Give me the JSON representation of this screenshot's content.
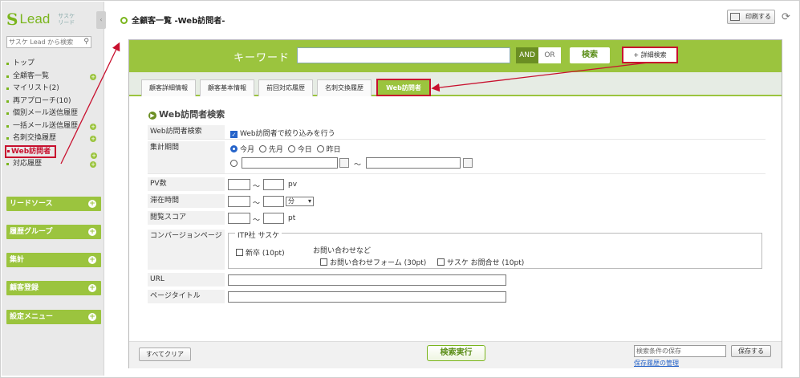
{
  "sidebar": {
    "logo_s": "S",
    "logo_text": "Lead",
    "logo_kana": "サスケ リード",
    "search_placeholder": "サスケ Lead から検索",
    "items": [
      {
        "label": "トップ"
      },
      {
        "label": "全顧客一覧"
      },
      {
        "label": "マイリスト(2)"
      },
      {
        "label": "再アプローチ(10)"
      },
      {
        "label": "個別メール送信履歴"
      },
      {
        "label": "一括メール送信履歴"
      },
      {
        "label": "名刺交換履歴"
      },
      {
        "label": "Web訪問者"
      },
      {
        "label": "対応履歴"
      }
    ],
    "groups": [
      {
        "label": "リードソース"
      },
      {
        "label": "履歴グループ"
      },
      {
        "label": "集計"
      },
      {
        "label": "顧客登録"
      },
      {
        "label": "設定メニュー"
      }
    ]
  },
  "header": {
    "title": "全顧客一覧 -Web訪問者-",
    "print_label": "印刷する"
  },
  "keyword": {
    "label": "キーワード",
    "value": "",
    "and_label": "AND",
    "or_label": "OR",
    "search_label": "検索",
    "advanced_label": "+ 詳細検索"
  },
  "tabs": [
    {
      "label": "顧客詳細情報"
    },
    {
      "label": "顧客基本情報"
    },
    {
      "label": "前回対応履歴"
    },
    {
      "label": "名刺交換履歴"
    },
    {
      "label": "Web訪問者"
    }
  ],
  "form": {
    "section_title": "Web訪問者検索",
    "visitor_label": "Web訪問者検索",
    "visitor_checkbox": "Web訪問者で絞り込みを行う",
    "period_label": "集計期間",
    "period_options": [
      "今月",
      "先月",
      "今日",
      "昨日"
    ],
    "period_selected": "今月",
    "range_sep": "～",
    "pv_label": "PV数",
    "pv_unit": "pv",
    "stay_label": "滞在時間",
    "stay_unit": "分",
    "score_label": "閲覧スコア",
    "score_unit": "pt",
    "conversion_label": "コンバージョンページ",
    "conv_group": "ITP社 サスケ",
    "conv_item1": "新卒 (10pt)",
    "conv_sub": "お問い合わせなど",
    "conv_item2": "お問い合わせフォーム (30pt)",
    "conv_item3": "サスケ お問合せ (10pt)",
    "url_label": "URL",
    "page_title_label": "ページタイトル"
  },
  "footer": {
    "clear_label": "すべてクリア",
    "exec_label": "検索実行",
    "save_placeholder": "検索条件の保存",
    "save_label": "保存する",
    "history_link": "保存履歴の管理"
  },
  "colors": {
    "accent": "#9bc43e",
    "highlight": "#c8102e",
    "link": "#2563c9"
  }
}
